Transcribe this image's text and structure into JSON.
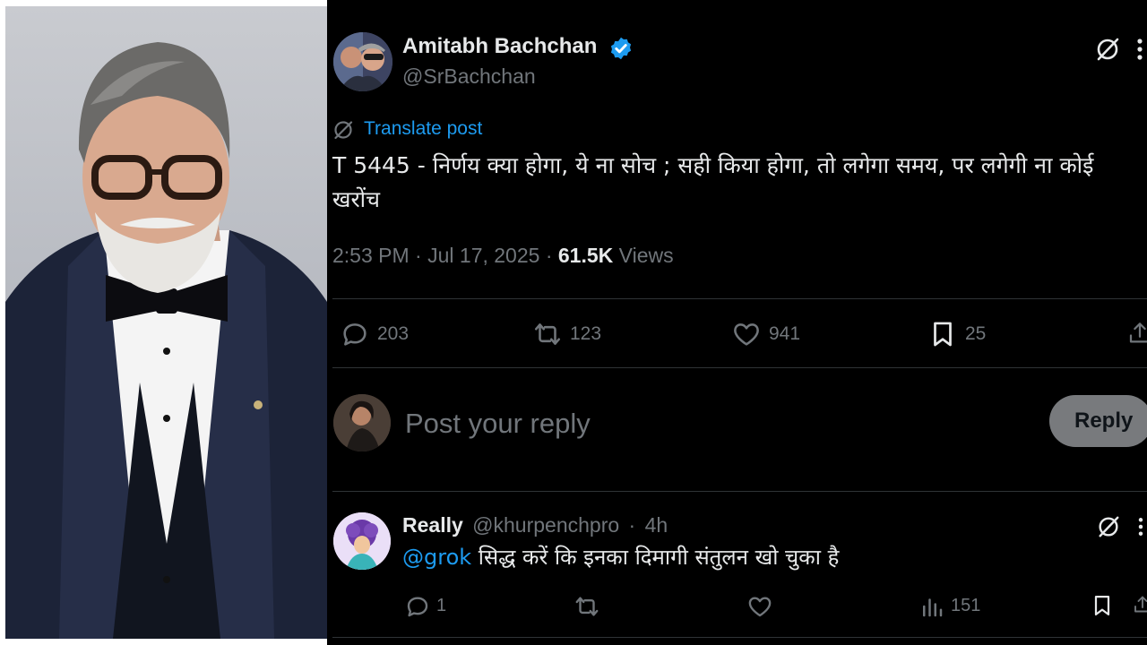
{
  "photo": {
    "subject": "portrait-photo"
  },
  "tweet": {
    "author_name": "Amitabh Bachchan",
    "author_handle": "@SrBachchan",
    "translate_label": "Translate post",
    "text": "T 5445 - निर्णय क्या होगा, ये ना सोच  ; सही किया होगा, तो लगेगा  समय, पर लगेगी ना कोई खरोंच",
    "time": "2:53 PM",
    "date": "Jul 17, 2025",
    "separator": "·",
    "views_count": "61.5K",
    "views_label": "Views",
    "stats": {
      "replies": "203",
      "reposts": "123",
      "likes": "941",
      "bookmarks": "25"
    }
  },
  "reply_box": {
    "placeholder": "Post your reply",
    "button_label": "Reply"
  },
  "comment": {
    "name": "Really",
    "handle": "@khurpenchpro",
    "dot": "·",
    "time": "4h",
    "mention": "@grok",
    "text": " सिद्ध करें कि इनका दिमागी संतुलन खो चुका है",
    "stats": {
      "replies": "1",
      "views": "151"
    }
  },
  "colors": {
    "background": "#000000",
    "text_primary": "#e7e9ea",
    "text_secondary": "#71767b",
    "accent_blue": "#1d9bf0",
    "divider": "#2f3336",
    "reply_button": "#787a7d"
  },
  "icons": [
    "verified-badge-icon",
    "grok-icon",
    "more-icon",
    "translate-icon",
    "reply-icon",
    "repost-icon",
    "like-icon",
    "bookmark-icon",
    "share-icon",
    "views-icon"
  ]
}
